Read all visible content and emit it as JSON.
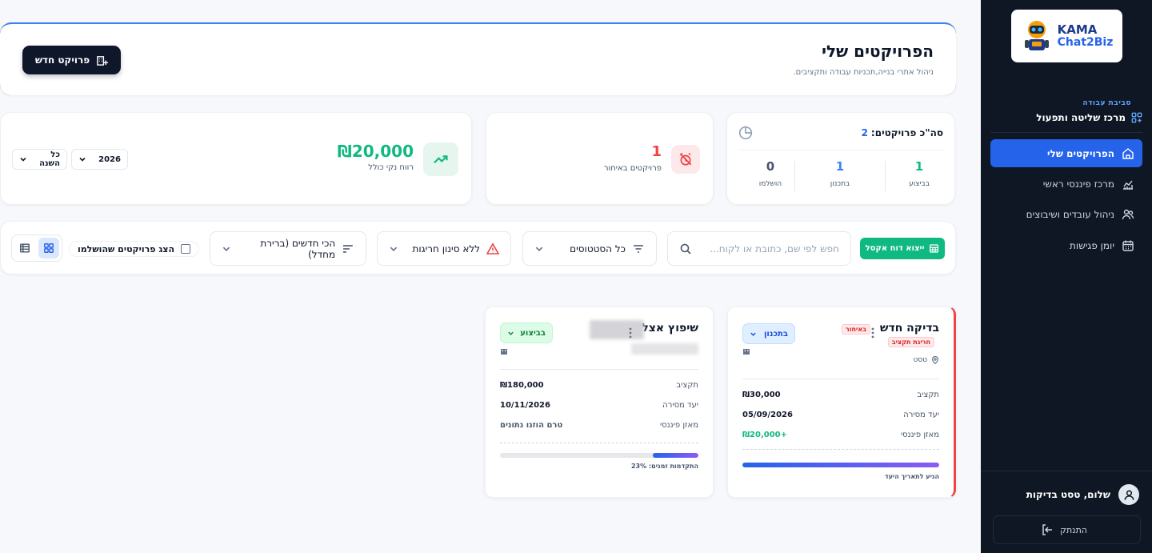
{
  "sidebar": {
    "logo_line1": "KAMA",
    "logo_line2": "Chat2Biz",
    "workspace_label": "סביבת עבודה",
    "workspace_title": "מרכז שליטה ותפעול",
    "items": [
      {
        "label": "הפרויקטים שלי",
        "icon": "house-hand-icon",
        "active": true
      },
      {
        "label": "מרכז פיננסי ראשי",
        "icon": "chart-icon",
        "active": false
      },
      {
        "label": "ניהול עובדים ושיבוצים",
        "icon": "users-icon",
        "active": false
      },
      {
        "label": "יומן פגישות",
        "icon": "calendar-icon",
        "active": false
      }
    ],
    "user_greeting": "שלום, טסט בדיקות",
    "logout_label": "התנתק"
  },
  "header": {
    "title": "הפרויקטים שלי",
    "subtitle": "ניהול אתרי בנייה,תכניות עבודה ותקציבים.",
    "new_project_label": "פרויקט חדש"
  },
  "stats": {
    "total_label": "סה\"כ פרויקטים:",
    "total_value": "2",
    "in_progress": {
      "value": "1",
      "label": "בביצוע"
    },
    "planning": {
      "value": "1",
      "label": "בתכנון"
    },
    "completed": {
      "value": "0",
      "label": "הושלמו"
    },
    "delayed": {
      "value": "1",
      "label": "פרויקטים באיחור"
    },
    "profit": {
      "value": "₪20,000",
      "label": "רווח נקי כולל"
    },
    "year_select": "2026",
    "period_select": "כל השנה"
  },
  "filters": {
    "export_label": "ייצוא דוח אקסל",
    "search_placeholder": "חפש לפי שם, כתובת או לקוח...",
    "status_filter": "כל הסטטוסים",
    "delay_filter": "ללא סינון חריגות",
    "sort": "הכי חדשים (ברירת מחדל)",
    "show_completed_label": "הצג פרויקטים שהושלמו"
  },
  "projects": [
    {
      "name": "בדיקה חדש",
      "badge_late": "באיחור",
      "badge_budget": "חריגת תקציב",
      "location": "טסט",
      "status": "בתכנון",
      "budget_label": "תקציב",
      "budget": "₪30,000",
      "delivery_label": "יעד מסירה",
      "delivery": "05/09/2026",
      "balance_label": "מאזן פיננסי",
      "balance": "+₪20,000",
      "progress_pct": 100,
      "progress_label": "הגיע לתאריך היעד"
    },
    {
      "name": "שיפוץ אצל",
      "status": "בביצוע",
      "budget_label": "תקציב",
      "budget": "₪180,000",
      "delivery_label": "יעד מסירה",
      "delivery": "10/11/2026",
      "balance_label": "מאזן פיננסי",
      "balance": "טרם הוזנו נתונים",
      "progress_pct": 23,
      "progress_label": "התקדמות זמנים: 23%"
    }
  ],
  "colors": {
    "sidebar_bg": "#0f1724",
    "accent_blue": "#2563eb",
    "success": "#10b981",
    "danger": "#ef4444"
  }
}
